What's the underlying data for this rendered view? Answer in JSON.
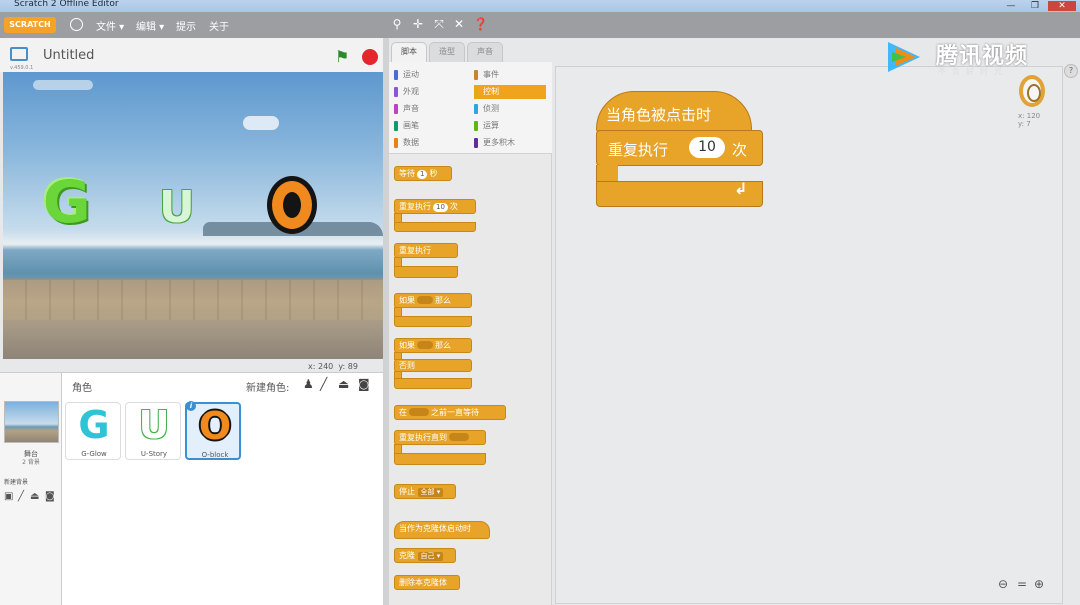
{
  "window": {
    "title": "Scratch 2 Offline Editor",
    "controls": [
      "—",
      "❐",
      "✕"
    ]
  },
  "menubar": {
    "logo": "SCRATCH",
    "items": [
      "文件 ▾",
      "编辑 ▾",
      "提示",
      "关于"
    ],
    "tools": [
      "duplicate-icon",
      "delete-icon",
      "grow-icon",
      "shrink-icon",
      "help-icon"
    ]
  },
  "stage": {
    "project_title": "Untitled",
    "version": "v.459.0.1",
    "coords_x_label": "x:",
    "coords_x": "240",
    "coords_y_label": "y:",
    "coords_y": "89",
    "sprites_on_stage": [
      {
        "letter": "G",
        "color": "#6ad63a"
      },
      {
        "letter": "U",
        "color": "#d8f5d6"
      },
      {
        "letter": "O",
        "color": "#f08a1e"
      }
    ]
  },
  "sprite_pane": {
    "sprites_label": "角色",
    "new_sprite_label": "新建角色:",
    "stage_name": "舞台",
    "stage_bg_count": "2 背景",
    "new_bg_label": "新建背景",
    "sprites": [
      {
        "glyph": "G",
        "name": "G-Glow",
        "color": "#2ec4d6"
      },
      {
        "glyph": "U",
        "name": "U-Story",
        "color": "#4caf50"
      },
      {
        "glyph": "O",
        "name": "O-block",
        "color": "#f08a1e"
      }
    ],
    "info_icon": "i"
  },
  "tabs": [
    "脚本",
    "造型",
    "声音"
  ],
  "categories": [
    {
      "label": "运动",
      "color": "#4a6cd4"
    },
    {
      "label": "事件",
      "color": "#c88330"
    },
    {
      "label": "外观",
      "color": "#8a55d7"
    },
    {
      "label": "控制",
      "color": "#e1a91a"
    },
    {
      "label": "声音",
      "color": "#bb42c3"
    },
    {
      "label": "侦测",
      "color": "#2ca5e2"
    },
    {
      "label": "画笔",
      "color": "#0e9a6c"
    },
    {
      "label": "运算",
      "color": "#5cb712"
    },
    {
      "label": "数据",
      "color": "#ee7d16"
    },
    {
      "label": "更多积木",
      "color": "#632d99"
    }
  ],
  "palette_blocks": {
    "wait": "等待",
    "wait_value": "1",
    "wait_unit": "秒",
    "repeat": "重复执行",
    "repeat_value": "10",
    "repeat_unit": "次",
    "forever": "重复执行",
    "if": "如果",
    "then": "那么",
    "if2": "如果",
    "then2": "那么",
    "else": "否则",
    "wait_until_prefix": "在",
    "wait_until_suffix": "之前一直等待",
    "repeat_until": "重复执行直到",
    "stop": "停止",
    "stop_option": "全部 ▾",
    "clone_hat": "当作为克隆体启动时",
    "clone": "克隆",
    "clone_option": "自己 ▾",
    "delete_clone": "删除本克隆体"
  },
  "script": {
    "hat": "当角色被点击时",
    "repeat_label": "重复执行",
    "repeat_times": "10",
    "repeat_unit": "次",
    "loop_arrow": "↲"
  },
  "sprite_info": {
    "x_label": "x:",
    "x": "120",
    "y_label": "y:",
    "y": "7"
  },
  "zoom": [
    "zoom-out-icon",
    "zoom-reset-icon",
    "zoom-in-icon"
  ],
  "watermark": {
    "text": "腾讯视频",
    "sub": "不负好时光"
  },
  "colors": {
    "control": "#e7a428",
    "accent": "#3c8fd0",
    "stop": "#e4262c",
    "flag": "#2c8a2c"
  }
}
